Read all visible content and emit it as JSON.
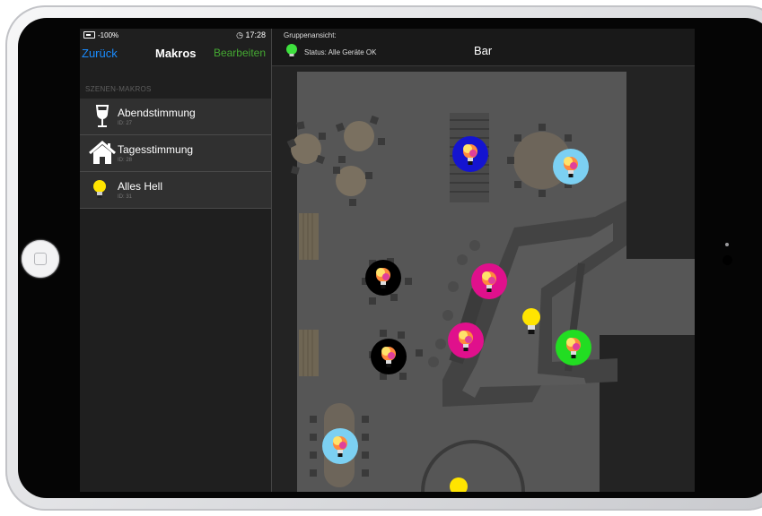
{
  "macros_panel": {
    "battery": "-100%",
    "time": "17:28",
    "back_label": "Zurück",
    "title": "Makros",
    "edit_label": "Bearbeiten",
    "section_header": "SZENEN-MAKROS",
    "items": [
      {
        "name": "Abendstimmung",
        "id_text": "ID: 27",
        "icon": "wine-glass-icon"
      },
      {
        "name": "Tagesstimmung",
        "id_text": "ID: 28",
        "icon": "house-icon"
      },
      {
        "name": "Alles Hell",
        "id_text": "ID: 31",
        "icon": "yellow-bulb-icon"
      }
    ]
  },
  "group_view": {
    "label": "Gruppenansicht:",
    "status": "Status: Alle Geräte OK",
    "title": "Bar"
  },
  "lamps": [
    {
      "name": "lamp-blue-top",
      "color": "#1414d0",
      "kind": "rgb"
    },
    {
      "name": "lamp-lightblue-top-right",
      "color": "#7cd0f2",
      "kind": "rgb"
    },
    {
      "name": "lamp-black-1",
      "color": "#000000",
      "kind": "rgb"
    },
    {
      "name": "lamp-magenta-1",
      "color": "#e0108c",
      "kind": "rgb"
    },
    {
      "name": "lamp-yellow-1",
      "color": "#ffe400",
      "kind": "plain"
    },
    {
      "name": "lamp-magenta-2",
      "color": "#e0108c",
      "kind": "rgb"
    },
    {
      "name": "lamp-green",
      "color": "#22dd22",
      "kind": "rgb"
    },
    {
      "name": "lamp-black-2",
      "color": "#000000",
      "kind": "rgb"
    },
    {
      "name": "lamp-lightblue-bottom",
      "color": "#7cd0f2",
      "kind": "rgb"
    },
    {
      "name": "lamp-yellow-bottom",
      "color": "#ffe400",
      "kind": "plain"
    }
  ]
}
